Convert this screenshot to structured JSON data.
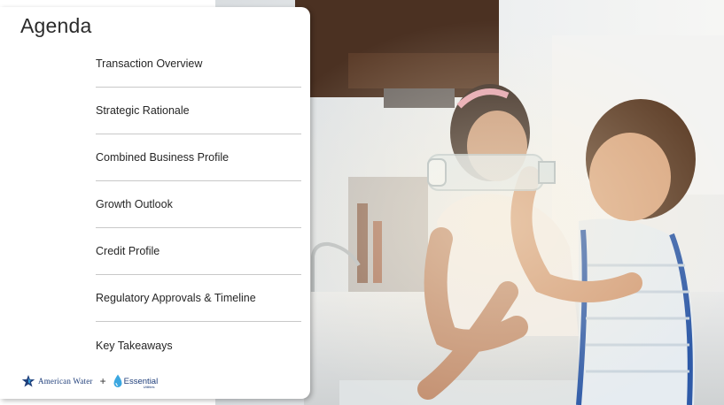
{
  "slide": {
    "title": "Agenda",
    "items": [
      {
        "label": "Transaction Overview"
      },
      {
        "label": "Strategic Rationale"
      },
      {
        "label": "Combined Business Profile"
      },
      {
        "label": "Growth Outlook"
      },
      {
        "label": "Credit Profile"
      },
      {
        "label": "Regulatory Approvals & Timeline"
      },
      {
        "label": "Key Takeaways"
      }
    ]
  },
  "footer": {
    "left_logo": {
      "icon": "star-icon",
      "text": "American Water"
    },
    "separator": "+",
    "right_logo": {
      "icon": "water-drop-icon",
      "text": "Essential",
      "subtext": "Utilities"
    }
  },
  "colors": {
    "brand_blue": "#1f3e7a",
    "drop_blue": "#3ba7e0",
    "divider": "#c8c8c8"
  }
}
